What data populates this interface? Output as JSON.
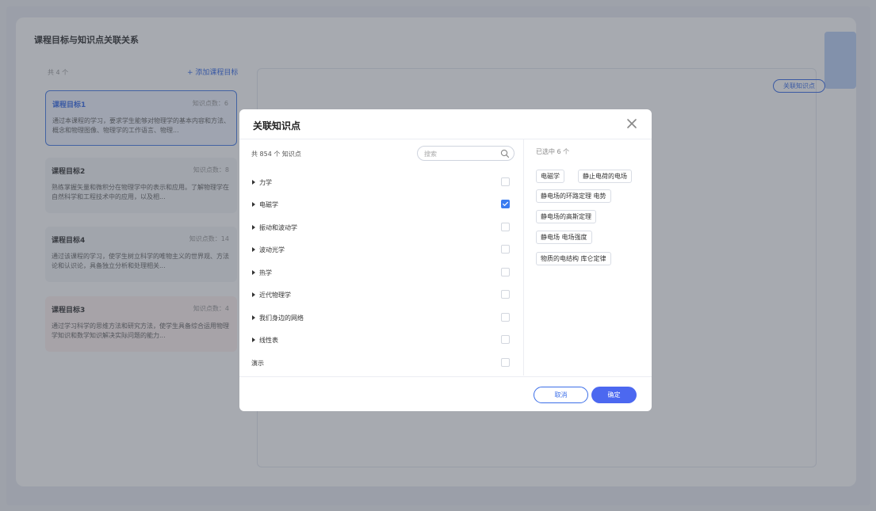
{
  "background": {
    "page_title": "课程目标与知识点关联关系",
    "goals_count": "共 4 个",
    "add_goal_label": "+ 添加课程目标",
    "link_button_label": "关联知识点",
    "goals": [
      {
        "title": "课程目标1",
        "count": "知识点数：6",
        "desc": "通过本课程的学习，要求学生能够对物理学的基本内容和方法、概念和物理图像、物理学的工作语言、物理..."
      },
      {
        "title": "课程目标2",
        "count": "知识点数：8",
        "desc": "熟练掌握矢量和微积分在物理学中的表示和应用。了解物理学在自然科学和工程技术中的应用，以及相..."
      },
      {
        "title": "课程目标4",
        "count": "知识点数：14",
        "desc": "通过该课程的学习，使学生树立科学的唯物主义的世界观、方法论和认识论，具备独立分析和处理相关..."
      },
      {
        "title": "课程目标3",
        "count": "知识点数：4",
        "desc": "通过学习科学的思维方法和研究方法，使学生具备综合运用物理学知识和数学知识解决实际问题的能力..."
      }
    ]
  },
  "modal": {
    "title": "关联知识点",
    "total_count": "共 854 个 知识点",
    "search_placeholder": "搜索",
    "selected_count": "已选中 6 个",
    "tree": [
      {
        "label": "力学",
        "expandable": true,
        "checked": false
      },
      {
        "label": "电磁学",
        "expandable": true,
        "checked": true
      },
      {
        "label": "振动和波动学",
        "expandable": true,
        "checked": false
      },
      {
        "label": "波动光学",
        "expandable": true,
        "checked": false
      },
      {
        "label": "热学",
        "expandable": true,
        "checked": false
      },
      {
        "label": "近代物理学",
        "expandable": true,
        "checked": false
      },
      {
        "label": "我们身边的网络",
        "expandable": true,
        "checked": false
      },
      {
        "label": "线性表",
        "expandable": true,
        "checked": false
      },
      {
        "label": "演示",
        "expandable": false,
        "checked": false
      }
    ],
    "selected_tags": [
      "电磁学",
      "静止电荷的电场",
      "静电场的环路定理 电势",
      "静电场的高斯定理",
      "静电场 电场强度",
      "物质的电结构 库仑定律"
    ],
    "cancel_label": "取消",
    "ok_label": "确定"
  },
  "colors": {
    "accent": "#3b6ee8",
    "checked": "#3b7cf0",
    "ok_button": "#4c68f0"
  }
}
